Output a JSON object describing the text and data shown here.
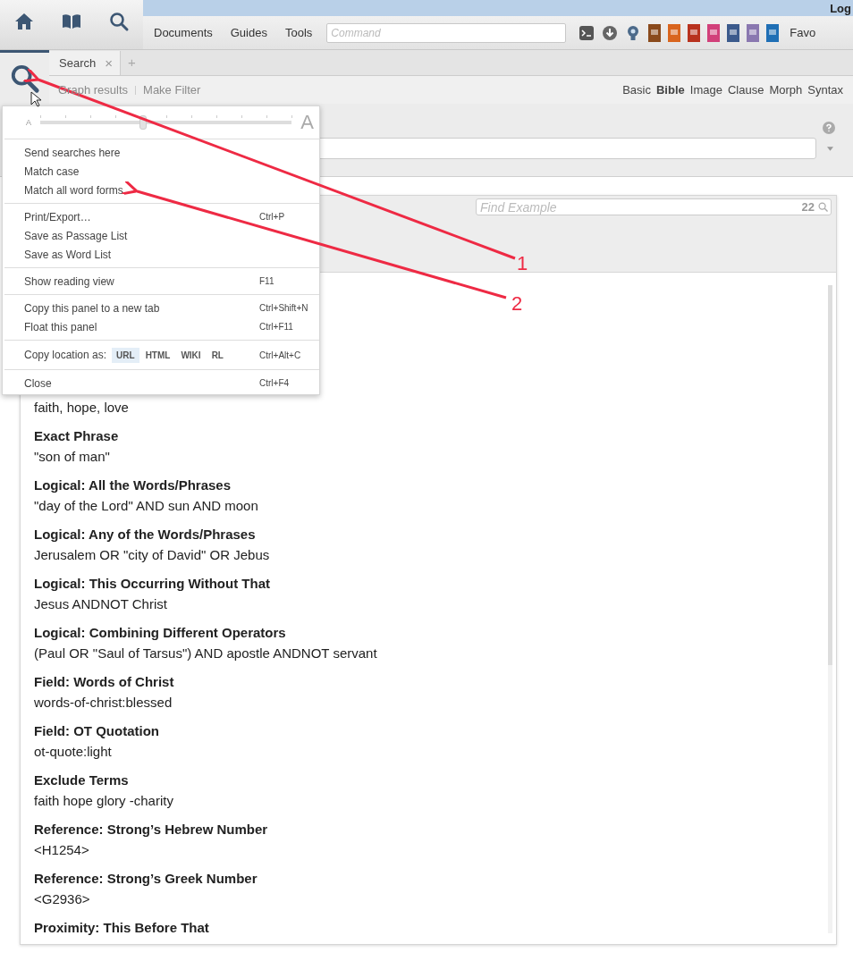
{
  "top_bar": {
    "account": "Log",
    "menus": [
      {
        "label": "Documents"
      },
      {
        "label": "Guides"
      },
      {
        "label": "Tools"
      }
    ],
    "command": {
      "placeholder": "Command"
    },
    "toolbar_icons": [
      {
        "kind": "terminal"
      },
      {
        "kind": "download"
      },
      {
        "kind": "bulb"
      },
      {
        "kind": "book",
        "color": "#8a4a1c"
      },
      {
        "kind": "book",
        "color": "#d9651e"
      },
      {
        "kind": "book",
        "color": "#b8321e"
      },
      {
        "kind": "book",
        "color": "#d2407a"
      },
      {
        "kind": "book",
        "color": "#3b5a8c"
      },
      {
        "kind": "book",
        "color": "#8a78b0"
      },
      {
        "kind": "book",
        "color": "#1f6fb5"
      }
    ],
    "favorites": "Favo"
  },
  "panel": {
    "tabs": [
      {
        "label": "Search",
        "selected": true,
        "close": "×"
      }
    ],
    "new_tab": "+",
    "actions": [
      {
        "label": "Graph results",
        "disabled": true
      },
      {
        "label": "Make Filter",
        "disabled": true
      }
    ],
    "modes": [
      {
        "label": "Basic",
        "selected": false
      },
      {
        "label": "Bible",
        "selected": true
      },
      {
        "label": "Image",
        "selected": false
      },
      {
        "label": "Clause",
        "selected": false
      },
      {
        "label": "Morph",
        "selected": false
      },
      {
        "label": "Syntax",
        "selected": false
      }
    ]
  },
  "examples": {
    "find": {
      "placeholder": "Find Example",
      "count": "22"
    },
    "items": [
      {
        "query": "faith, hope, love"
      },
      {
        "title": "Exact Phrase",
        "query": "\"son of man\""
      },
      {
        "title": "Logical: All the Words/Phrases",
        "query": "\"day of the Lord\" AND sun AND moon"
      },
      {
        "title": "Logical: Any of the Words/Phrases",
        "query": "Jerusalem OR \"city of David\" OR Jebus"
      },
      {
        "title": "Logical: This Occurring Without That",
        "query": "Jesus ANDNOT Christ"
      },
      {
        "title": "Logical: Combining Different Operators",
        "query": "(Paul OR \"Saul of Tarsus\") AND apostle ANDNOT servant"
      },
      {
        "title": "Field: Words of Christ",
        "query": "words-of-christ:blessed"
      },
      {
        "title": "Field: OT Quotation",
        "query": "ot-quote:light"
      },
      {
        "title": "Exclude Terms",
        "query": "faith hope glory -charity"
      },
      {
        "title": "Reference: Strong’s Hebrew Number",
        "query": "<H1254>"
      },
      {
        "title": "Reference: Strong’s Greek Number",
        "query": "<G2936>"
      },
      {
        "title": "Proximity: This Before That"
      }
    ]
  },
  "menu": {
    "items": [
      {
        "kind": "slider",
        "small": "A",
        "large": "A",
        "level": 0.41
      },
      {
        "kind": "separator"
      },
      {
        "kind": "item",
        "label": "Send searches here"
      },
      {
        "kind": "item",
        "label": "Match case"
      },
      {
        "kind": "item",
        "label": "Match all word forms"
      },
      {
        "kind": "separator"
      },
      {
        "kind": "item",
        "label": "Print/Export…",
        "shortcut": "Ctrl+P"
      },
      {
        "kind": "item",
        "label": "Save as Passage List"
      },
      {
        "kind": "item",
        "label": "Save as Word List"
      },
      {
        "kind": "separator"
      },
      {
        "kind": "item",
        "label": "Show reading view",
        "shortcut": "F11"
      },
      {
        "kind": "separator"
      },
      {
        "kind": "item",
        "label": "Copy this panel to a new tab",
        "shortcut": "Ctrl+Shift+N"
      },
      {
        "kind": "item",
        "label": "Float this panel",
        "shortcut": "Ctrl+F11"
      },
      {
        "kind": "separator"
      },
      {
        "kind": "location",
        "label": "Copy location as:",
        "formats": [
          {
            "label": "URL",
            "selected": true
          },
          {
            "label": "HTML",
            "selected": false
          },
          {
            "label": "WIKI",
            "selected": false
          },
          {
            "label": "RL",
            "selected": false
          }
        ],
        "shortcut": "Ctrl+Alt+C"
      },
      {
        "kind": "separator"
      },
      {
        "kind": "item",
        "label": "Close",
        "shortcut": "Ctrl+F4"
      }
    ]
  },
  "annotations": [
    {
      "label": "1"
    },
    {
      "label": "2"
    }
  ]
}
